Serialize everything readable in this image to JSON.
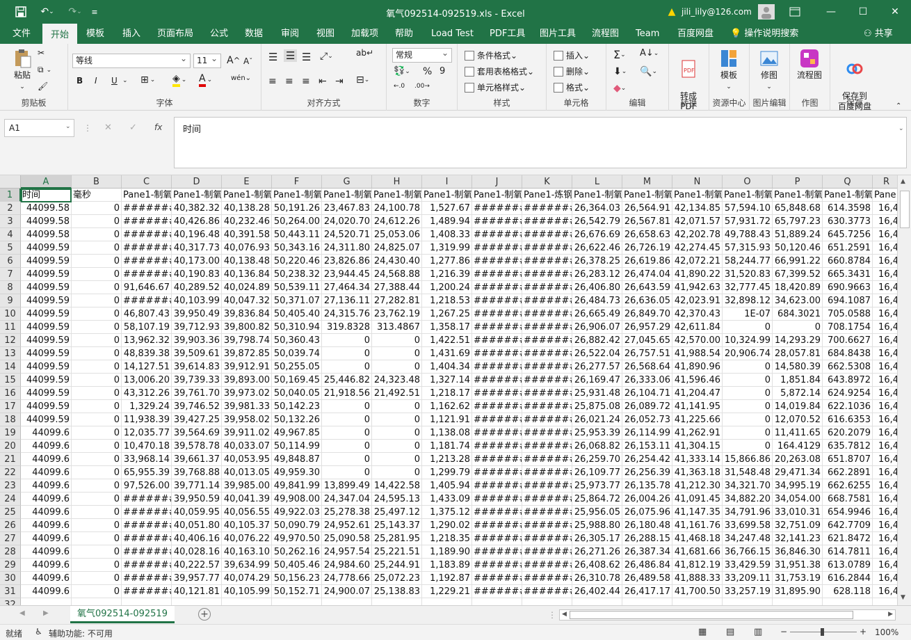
{
  "window": {
    "title": "氧气092514-092519.xls  -  Excel",
    "user": "jili_lily@126.com",
    "qat": {
      "save": "save-icon",
      "undo": "undo-icon",
      "redo": "redo-icon"
    }
  },
  "tabs": [
    {
      "label": "文件"
    },
    {
      "label": "开始"
    },
    {
      "label": "模板"
    },
    {
      "label": "插入"
    },
    {
      "label": "页面布局"
    },
    {
      "label": "公式"
    },
    {
      "label": "数据"
    },
    {
      "label": "审阅"
    },
    {
      "label": "视图"
    },
    {
      "label": "加载项"
    },
    {
      "label": "帮助"
    },
    {
      "label": "Load Test"
    },
    {
      "label": "PDF工具"
    },
    {
      "label": "图片工具"
    },
    {
      "label": "流程图"
    },
    {
      "label": "Team"
    },
    {
      "label": "百度网盘"
    },
    {
      "label": "操作说明搜索"
    },
    {
      "label": "共享"
    }
  ],
  "ribbon": {
    "clipboard": {
      "label": "剪贴板",
      "paste": "粘贴"
    },
    "font": {
      "label": "字体",
      "name": "等线",
      "size": "11",
      "bold": "B",
      "italic": "I",
      "underline": "U",
      "grow": "A",
      "shrink": "A",
      "wen": "wén"
    },
    "align": {
      "label": "对齐方式"
    },
    "number": {
      "label": "数字",
      "format": "常规",
      "percent": "%",
      "comma": "9"
    },
    "styles": {
      "label": "样式",
      "cond": "条件格式",
      "table": "套用表格格式",
      "cell": "单元格样式"
    },
    "cells": {
      "label": "单元格",
      "insert": "插入",
      "delete": "删除",
      "format": "格式"
    },
    "editing": {
      "label": "编辑"
    },
    "convert": {
      "label": "转换",
      "btn": "转成\nPDF"
    },
    "resource": {
      "label": "资源中心",
      "btn": "模板"
    },
    "image": {
      "label": "图片编辑",
      "btn": "修图"
    },
    "drawing": {
      "label": "作图",
      "btn": "流程图"
    },
    "save": {
      "label": "保存",
      "btn": "保存到\n百度网盘"
    }
  },
  "formula_bar": {
    "name_box": "A1",
    "fx": "fx",
    "content": "时间"
  },
  "sheet": {
    "columns": [
      "A",
      "B",
      "C",
      "D",
      "E",
      "F",
      "G",
      "H",
      "I",
      "J",
      "K",
      "L",
      "M",
      "N",
      "O",
      "P",
      "Q",
      "R"
    ],
    "header_row": [
      "时间",
      "毫秒",
      "Pane1-制氧",
      "Pane1-制氧",
      "Pane1-制氧",
      "Pane1-制氧",
      "Pane1-制氧",
      "Pane1-制氧",
      "Pane1-制氧",
      "Pane1-制氧",
      "Pane1-炼钢",
      "Pane1-制氧",
      "Pane1-制氧",
      "Pane1-制氧",
      "Pane1-制氧",
      "Pane1-制氧",
      "Pane1-制氧",
      "Pane"
    ],
    "rows": [
      [
        "44099.58",
        "0",
        "#######",
        "40,382.32",
        "40,138.28",
        "50,191.26",
        "23,467.83",
        "24,100.78",
        "1,527.67",
        "#######",
        "#######",
        "26,364.03",
        "26,564.91",
        "42,134.85",
        "57,594.10",
        "65,848.68",
        "614.3598",
        "16,4"
      ],
      [
        "44099.58",
        "0",
        "#######",
        "40,426.86",
        "40,232.46",
        "50,264.00",
        "24,020.70",
        "24,612.26",
        "1,489.94",
        "#######",
        "#######",
        "26,542.79",
        "26,567.81",
        "42,071.57",
        "57,931.72",
        "65,797.23",
        "630.3773",
        "16,4"
      ],
      [
        "44099.58",
        "0",
        "#######",
        "40,196.48",
        "40,391.58",
        "50,443.11",
        "24,520.71",
        "25,053.06",
        "1,408.33",
        "#######",
        "#######",
        "26,676.69",
        "26,658.63",
        "42,202.78",
        "49,788.43",
        "51,889.24",
        "645.7256",
        "16,4"
      ],
      [
        "44099.59",
        "0",
        "#######",
        "40,317.73",
        "40,076.93",
        "50,343.16",
        "24,311.80",
        "24,825.07",
        "1,319.99",
        "#######",
        "#######",
        "26,622.46",
        "26,726.19",
        "42,274.45",
        "57,315.93",
        "50,120.46",
        "651.2591",
        "16,4"
      ],
      [
        "44099.59",
        "0",
        "#######",
        "40,173.00",
        "40,138.48",
        "50,220.46",
        "23,826.86",
        "24,430.40",
        "1,277.86",
        "#######",
        "#######",
        "26,378.25",
        "26,619.86",
        "42,072.21",
        "58,244.77",
        "66,991.22",
        "660.8784",
        "16,4"
      ],
      [
        "44099.59",
        "0",
        "#######",
        "40,190.83",
        "40,136.84",
        "50,238.32",
        "23,944.45",
        "24,568.88",
        "1,216.39",
        "#######",
        "#######",
        "26,283.12",
        "26,474.04",
        "41,890.22",
        "31,520.83",
        "67,399.52",
        "665.3431",
        "16,4"
      ],
      [
        "44099.59",
        "0",
        "91,646.67",
        "40,289.52",
        "40,024.89",
        "50,539.11",
        "27,464.34",
        "27,388.44",
        "1,200.24",
        "#######",
        "#######",
        "26,406.80",
        "26,643.59",
        "41,942.63",
        "32,777.45",
        "18,420.89",
        "690.9663",
        "16,4"
      ],
      [
        "44099.59",
        "0",
        "#######",
        "40,103.99",
        "40,047.32",
        "50,371.07",
        "27,136.11",
        "27,282.81",
        "1,218.53",
        "#######",
        "#######",
        "26,484.73",
        "26,636.05",
        "42,023.91",
        "32,898.12",
        "34,623.00",
        "694.1087",
        "16,4"
      ],
      [
        "44099.59",
        "0",
        "46,807.43",
        "39,950.49",
        "39,836.84",
        "50,405.40",
        "24,315.76",
        "23,762.19",
        "1,267.25",
        "#######",
        "#######",
        "26,665.49",
        "26,849.70",
        "42,370.43",
        "1E-07",
        "684.3021",
        "705.0588",
        "16,4"
      ],
      [
        "44099.59",
        "0",
        "58,107.19",
        "39,712.93",
        "39,800.82",
        "50,310.94",
        "319.8328",
        "313.4867",
        "1,358.17",
        "#######",
        "#######",
        "26,906.07",
        "26,957.29",
        "42,611.84",
        "0",
        "0",
        "708.1754",
        "16,4"
      ],
      [
        "44099.59",
        "0",
        "13,962.32",
        "39,903.36",
        "39,798.74",
        "50,360.43",
        "0",
        "0",
        "1,422.51",
        "#######",
        "#######",
        "26,882.42",
        "27,045.65",
        "42,570.00",
        "10,324.99",
        "14,293.29",
        "700.6627",
        "16,4"
      ],
      [
        "44099.59",
        "0",
        "48,839.38",
        "39,509.61",
        "39,872.85",
        "50,039.74",
        "0",
        "0",
        "1,431.69",
        "#######",
        "#######",
        "26,522.04",
        "26,757.51",
        "41,988.54",
        "20,906.74",
        "28,057.81",
        "684.8438",
        "16,4"
      ],
      [
        "44099.59",
        "0",
        "14,127.51",
        "39,614.83",
        "39,912.91",
        "50,255.05",
        "0",
        "0",
        "1,404.34",
        "#######",
        "#######",
        "26,277.57",
        "26,568.64",
        "41,890.96",
        "0",
        "14,580.39",
        "662.5308",
        "16,4"
      ],
      [
        "44099.59",
        "0",
        "13,006.20",
        "39,739.33",
        "39,893.00",
        "50,169.45",
        "25,446.82",
        "24,323.48",
        "1,327.14",
        "#######",
        "#######",
        "26,169.47",
        "26,333.06",
        "41,596.46",
        "0",
        "1,851.84",
        "643.8972",
        "16,4"
      ],
      [
        "44099.59",
        "0",
        "43,312.26",
        "39,761.70",
        "39,973.02",
        "50,040.05",
        "21,918.56",
        "21,492.51",
        "1,218.17",
        "#######",
        "#######",
        "25,931.48",
        "26,104.71",
        "41,204.47",
        "0",
        "5,872.14",
        "624.9254",
        "16,4"
      ],
      [
        "44099.59",
        "0",
        "1,329.24",
        "39,746.52",
        "39,981.33",
        "50,142.23",
        "0",
        "0",
        "1,162.62",
        "#######",
        "#######",
        "25,875.08",
        "26,089.72",
        "41,141.95",
        "0",
        "14,019.84",
        "622.1036",
        "16,4"
      ],
      [
        "44099.59",
        "0",
        "11,938.39",
        "39,427.25",
        "39,958.02",
        "50,132.26",
        "0",
        "0",
        "1,121.91",
        "#######",
        "#######",
        "26,021.24",
        "26,052.73",
        "41,225.66",
        "0",
        "12,070.52",
        "616.6353",
        "16,4"
      ],
      [
        "44099.6",
        "0",
        "12,035.77",
        "39,564.69",
        "39,911.02",
        "49,967.85",
        "0",
        "0",
        "1,138.08",
        "#######",
        "#######",
        "25,953.39",
        "26,114.99",
        "41,262.91",
        "0",
        "11,411.65",
        "620.2079",
        "16,4"
      ],
      [
        "44099.6",
        "0",
        "10,470.18",
        "39,578.78",
        "40,033.07",
        "50,114.99",
        "0",
        "0",
        "1,181.74",
        "#######",
        "#######",
        "26,068.82",
        "26,153.11",
        "41,304.15",
        "0",
        "164.4129",
        "635.7812",
        "16,4"
      ],
      [
        "44099.6",
        "0",
        "33,968.14",
        "39,661.37",
        "40,053.95",
        "49,848.87",
        "0",
        "0",
        "1,213.28",
        "#######",
        "#######",
        "26,259.70",
        "26,254.42",
        "41,333.14",
        "15,866.86",
        "20,263.08",
        "651.8707",
        "16,4"
      ],
      [
        "44099.6",
        "0",
        "65,955.39",
        "39,768.88",
        "40,013.05",
        "49,959.30",
        "0",
        "0",
        "1,299.79",
        "#######",
        "#######",
        "26,109.77",
        "26,256.39",
        "41,363.18",
        "31,548.48",
        "29,471.34",
        "662.2891",
        "16,4"
      ],
      [
        "44099.6",
        "0",
        "97,526.00",
        "39,771.14",
        "39,985.00",
        "49,841.99",
        "13,899.49",
        "14,422.58",
        "1,405.94",
        "#######",
        "#######",
        "25,973.77",
        "26,135.78",
        "41,212.30",
        "34,321.70",
        "34,995.19",
        "662.6255",
        "16,4"
      ],
      [
        "44099.6",
        "0",
        "#######",
        "39,950.59",
        "40,041.39",
        "49,908.00",
        "24,347.04",
        "24,595.13",
        "1,433.09",
        "#######",
        "#######",
        "25,864.72",
        "26,004.26",
        "41,091.45",
        "34,882.20",
        "34,054.00",
        "668.7581",
        "16,4"
      ],
      [
        "44099.6",
        "0",
        "#######",
        "40,059.95",
        "40,056.55",
        "49,922.03",
        "25,278.38",
        "25,497.12",
        "1,375.12",
        "#######",
        "#######",
        "25,956.05",
        "26,075.96",
        "41,147.35",
        "34,791.96",
        "33,010.31",
        "654.9946",
        "16,4"
      ],
      [
        "44099.6",
        "0",
        "#######",
        "40,051.80",
        "40,105.37",
        "50,090.79",
        "24,952.61",
        "25,143.37",
        "1,290.02",
        "#######",
        "#######",
        "25,988.80",
        "26,180.48",
        "41,161.76",
        "33,699.58",
        "32,751.09",
        "642.7709",
        "16,4"
      ],
      [
        "44099.6",
        "0",
        "#######",
        "40,406.16",
        "40,076.22",
        "49,970.50",
        "25,090.58",
        "25,281.95",
        "1,218.35",
        "#######",
        "#######",
        "26,305.17",
        "26,288.15",
        "41,468.18",
        "34,247.48",
        "32,141.23",
        "621.8472",
        "16,4"
      ],
      [
        "44099.6",
        "0",
        "#######",
        "40,028.16",
        "40,163.10",
        "50,262.16",
        "24,957.54",
        "25,221.51",
        "1,189.90",
        "#######",
        "#######",
        "26,271.26",
        "26,387.34",
        "41,681.66",
        "36,766.15",
        "36,846.30",
        "614.7811",
        "16,4"
      ],
      [
        "44099.6",
        "0",
        "#######",
        "40,222.57",
        "39,634.99",
        "50,405.46",
        "24,984.60",
        "25,244.91",
        "1,183.89",
        "#######",
        "#######",
        "26,408.62",
        "26,486.84",
        "41,812.19",
        "33,429.59",
        "31,951.38",
        "613.0789",
        "16,4"
      ],
      [
        "44099.6",
        "0",
        "#######",
        "39,957.77",
        "40,074.29",
        "50,156.23",
        "24,778.66",
        "25,072.23",
        "1,192.87",
        "#######",
        "#######",
        "26,310.78",
        "26,489.58",
        "41,888.33",
        "33,209.11",
        "31,753.19",
        "616.2844",
        "16,4"
      ],
      [
        "44099.6",
        "0",
        "#######",
        "40,121.81",
        "40,105.99",
        "50,152.71",
        "24,900.07",
        "25,138.83",
        "1,229.21",
        "#######",
        "#######",
        "26,402.44",
        "26,417.17",
        "41,700.50",
        "33,257.19",
        "31,895.90",
        "628.118",
        "16,4"
      ]
    ],
    "row_numbers": [
      "1",
      "2",
      "3",
      "4",
      "5",
      "6",
      "7",
      "8",
      "9",
      "10",
      "11",
      "12",
      "13",
      "14",
      "15",
      "16",
      "17",
      "18",
      "19",
      "20",
      "21",
      "22",
      "23",
      "24",
      "25",
      "26",
      "27",
      "28",
      "29",
      "30",
      "31",
      "32"
    ]
  },
  "sheet_tab": "氧气092514-092519",
  "status": {
    "ready": "就绪",
    "accessibility": "辅助功能: 不可用",
    "zoom": "100%"
  }
}
